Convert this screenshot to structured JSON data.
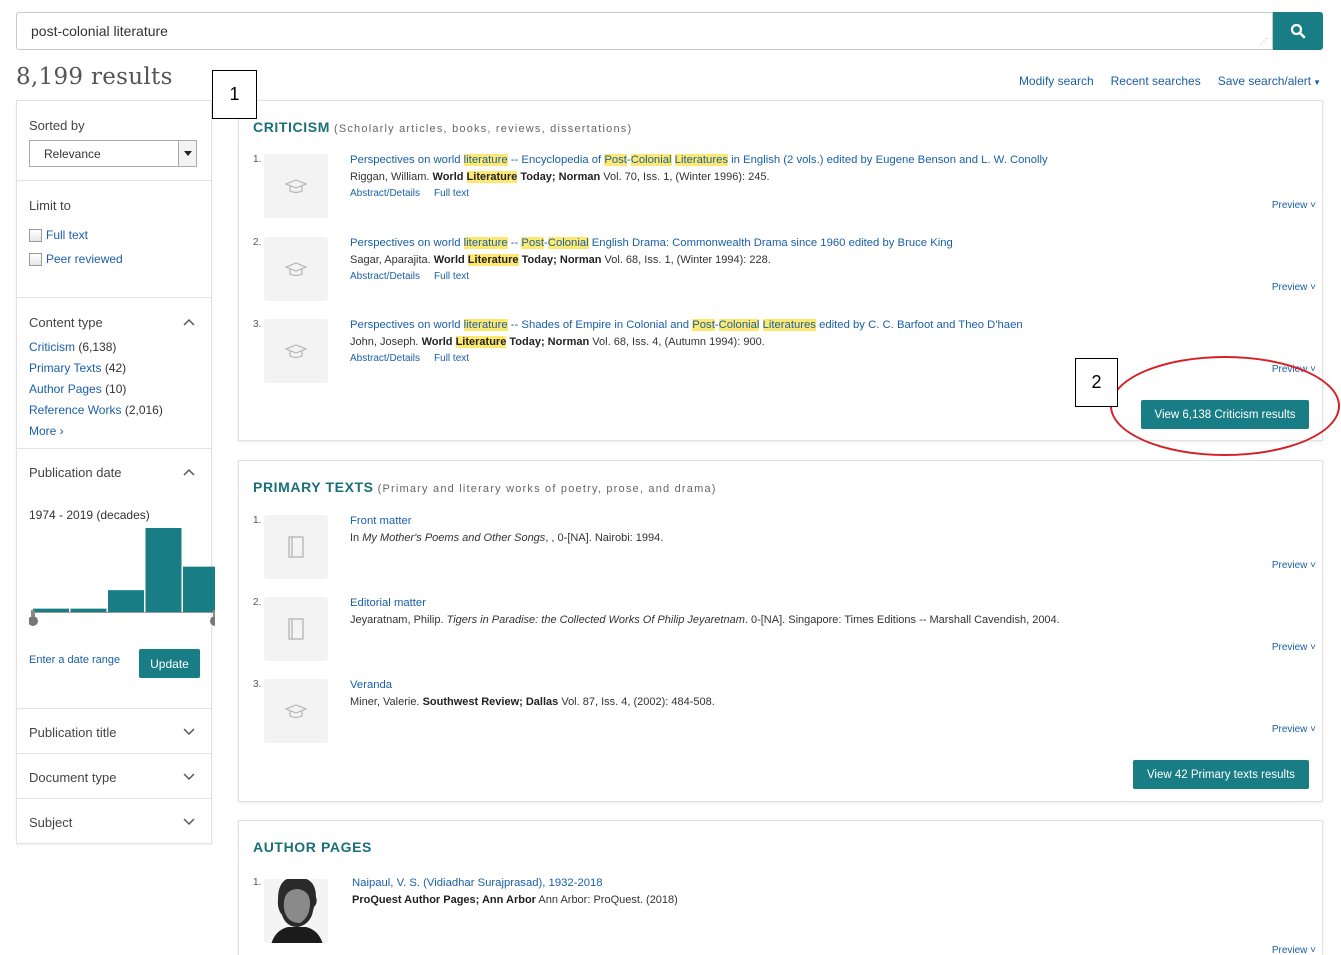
{
  "search": {
    "query": "post-colonial literature",
    "button_icon": "search-icon"
  },
  "results_count": "8,199 results",
  "top_links": {
    "modify": "Modify search",
    "recent": "Recent searches",
    "save": "Save search/alert"
  },
  "annotations": {
    "box1": "1",
    "box2": "2"
  },
  "sidebar": {
    "sorted_by_label": "Sorted by",
    "sort_value": "Relevance",
    "limit_label": "Limit to",
    "full_text": "Full text",
    "peer_reviewed": "Peer reviewed",
    "content_type_label": "Content type",
    "content_types": [
      {
        "label": "Criticism",
        "count": "(6,138)"
      },
      {
        "label": "Primary Texts",
        "count": "(42)"
      },
      {
        "label": "Author Pages",
        "count": "(10)"
      },
      {
        "label": "Reference Works",
        "count": "(2,016)"
      }
    ],
    "more": "More ›",
    "pubdate_label": "Publication date",
    "pubdate_range": "1974 - 2019 (decades)",
    "histogram": [
      0.04,
      0.04,
      0.26,
      1.0,
      0.54
    ],
    "enter_range": "Enter a date range",
    "update": "Update",
    "pubtitle_label": "Publication title",
    "doctype_label": "Document type",
    "subject_label": "Subject"
  },
  "criticism": {
    "title": "CRITICISM",
    "subtitle": "(Scholarly articles, books, reviews, dissertations)",
    "items": [
      {
        "num": "1.",
        "t1": "Perspectives on world ",
        "t2": "literature",
        "t3": " -- Encyclopedia of ",
        "t4": "Post",
        "t5": "-",
        "t6": "Colonial",
        "t7": " ",
        "t8": "Literatures",
        "t9": " in English (2 vols.) edited by Eugene Benson and L. W. Conolly",
        "c1": "Riggan, William. ",
        "c2": "World ",
        "c3": "Literature",
        "c4": " Today; Norman",
        "c5": " Vol. 70, Iss. 1,  (Winter 1996): 245.",
        "link1": "Abstract/Details",
        "link2": "Full text"
      },
      {
        "num": "2.",
        "t1": "Perspectives on world ",
        "t2": "literature",
        "t3": " -- ",
        "t4": "Post",
        "t5": "-",
        "t6": "Colonial",
        "t7": " English Drama: Commonwealth Drama since 1960 edited by Bruce King",
        "t8": "",
        "t9": "",
        "c1": "Sagar, Aparajita. ",
        "c2": "World ",
        "c3": "Literature",
        "c4": " Today; Norman",
        "c5": " Vol. 68, Iss. 1,  (Winter 1994): 228.",
        "link1": "Abstract/Details",
        "link2": "Full text"
      },
      {
        "num": "3.",
        "t1": "Perspectives on world ",
        "t2": "literature",
        "t3": " -- Shades of Empire in Colonial and ",
        "t4": "Post",
        "t5": "-",
        "t6": "Colonial",
        "t7": " ",
        "t8": "Literatures",
        "t9": " edited by C. C. Barfoot and Theo D'haen",
        "c1": "John, Joseph. ",
        "c2": "World ",
        "c3": "Literature",
        "c4": " Today; Norman",
        "c5": " Vol. 68, Iss. 4,  (Autumn 1994): 900.",
        "link1": "Abstract/Details",
        "link2": "Full text"
      }
    ],
    "preview": "Preview ˅",
    "view_button": "View 6,138 Criticism results"
  },
  "primary": {
    "title": "PRIMARY TEXTS",
    "subtitle": "(Primary and literary works of poetry, prose, and drama)",
    "items": [
      {
        "num": "1.",
        "title": "Front matter",
        "c1": "In ",
        "c2": "My Mother's Poems and Other Songs",
        "c3": ", , 0-[NA]. Nairobi: 1994."
      },
      {
        "num": "2.",
        "title": "Editorial matter",
        "c1": "Jeyaratnam, Philip. ",
        "c2": "Tigers in Paradise: the Collected Works Of Philip Jeyaretnam",
        "c3": ". 0-[NA]. Singapore: Times Editions -- Marshall Cavendish, 2004."
      },
      {
        "num": "3.",
        "title": "Veranda",
        "c1": "Miner, Valerie. ",
        "c2": "Southwest Review; Dallas",
        "c3": " Vol. 87, Iss. 4,  (2002): 484-508."
      }
    ],
    "preview": "Preview ˅",
    "view_button": "View 42 Primary texts results"
  },
  "author": {
    "title": "AUTHOR PAGES",
    "items": [
      {
        "num": "1.",
        "title": "Naipaul, V. S. (Vidiadhar Surajprasad), 1932-2018",
        "c1": "ProQuest Author Pages; Ann Arbor",
        "c2": " Ann Arbor: ProQuest. (2018)"
      }
    ],
    "preview": "Preview ˅"
  }
}
